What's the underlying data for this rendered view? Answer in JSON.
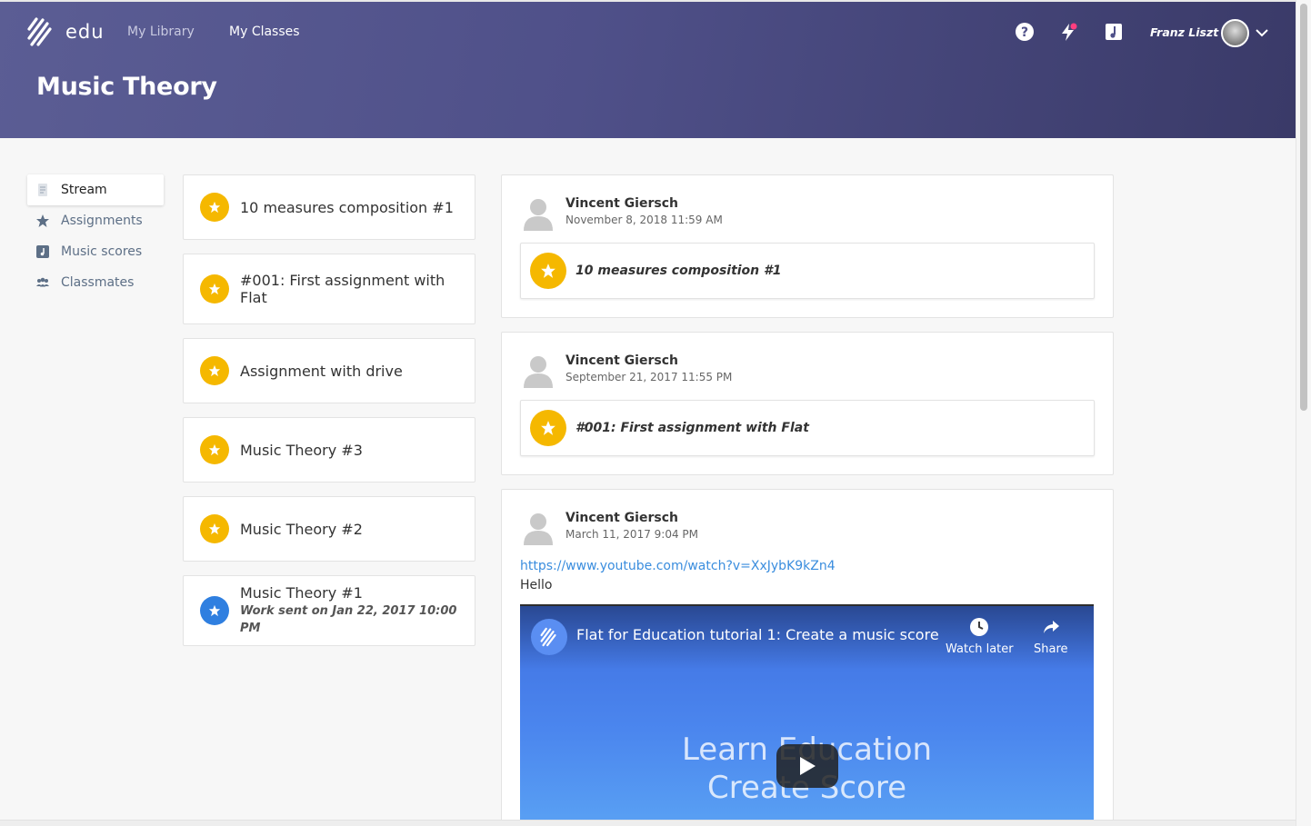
{
  "header": {
    "brand": "edu",
    "nav": {
      "library": "My Library",
      "classes": "My Classes"
    },
    "class_title": "Music Theory",
    "user_name": "Franz Liszt",
    "icons": [
      "help-icon",
      "activity-icon",
      "scores-icon",
      "chevron-down-icon"
    ]
  },
  "sidebar": {
    "items": [
      {
        "label": "Stream",
        "icon": "stream-icon",
        "active": true
      },
      {
        "label": "Assignments",
        "icon": "star-icon"
      },
      {
        "label": "Music scores",
        "icon": "music-score-icon"
      },
      {
        "label": "Classmates",
        "icon": "people-icon"
      }
    ]
  },
  "assignments": [
    {
      "title": "10 measures composition #1",
      "color": "#f5b800"
    },
    {
      "title": "#001: First assignment with Flat",
      "color": "#f5b800"
    },
    {
      "title": "Assignment with drive",
      "color": "#f5b800"
    },
    {
      "title": "Music Theory #3",
      "color": "#f5b800"
    },
    {
      "title": "Music Theory #2",
      "color": "#f5b800"
    },
    {
      "title": "Music Theory #1",
      "subtitle": "Work sent on Jan 22, 2017 10:00 PM",
      "color": "#2f7fe0"
    }
  ],
  "stream": [
    {
      "author": "Vincent Giersch",
      "date": "November 8, 2018 11:59 AM",
      "attachment": "10 measures composition #1"
    },
    {
      "author": "Vincent Giersch",
      "date": "September 21, 2017 11:55 PM",
      "attachment": "#001: First assignment with Flat"
    },
    {
      "author": "Vincent Giersch",
      "date": "March 11, 2017 9:04 PM",
      "link": "https://www.youtube.com/watch?v=XxJybK9kZn4",
      "text": "Hello",
      "video": {
        "title": "Flat for Education tutorial 1: Create a music score",
        "watch_later": "Watch later",
        "share": "Share",
        "line1": "Learn Education",
        "line2": "Create Score"
      }
    }
  ]
}
